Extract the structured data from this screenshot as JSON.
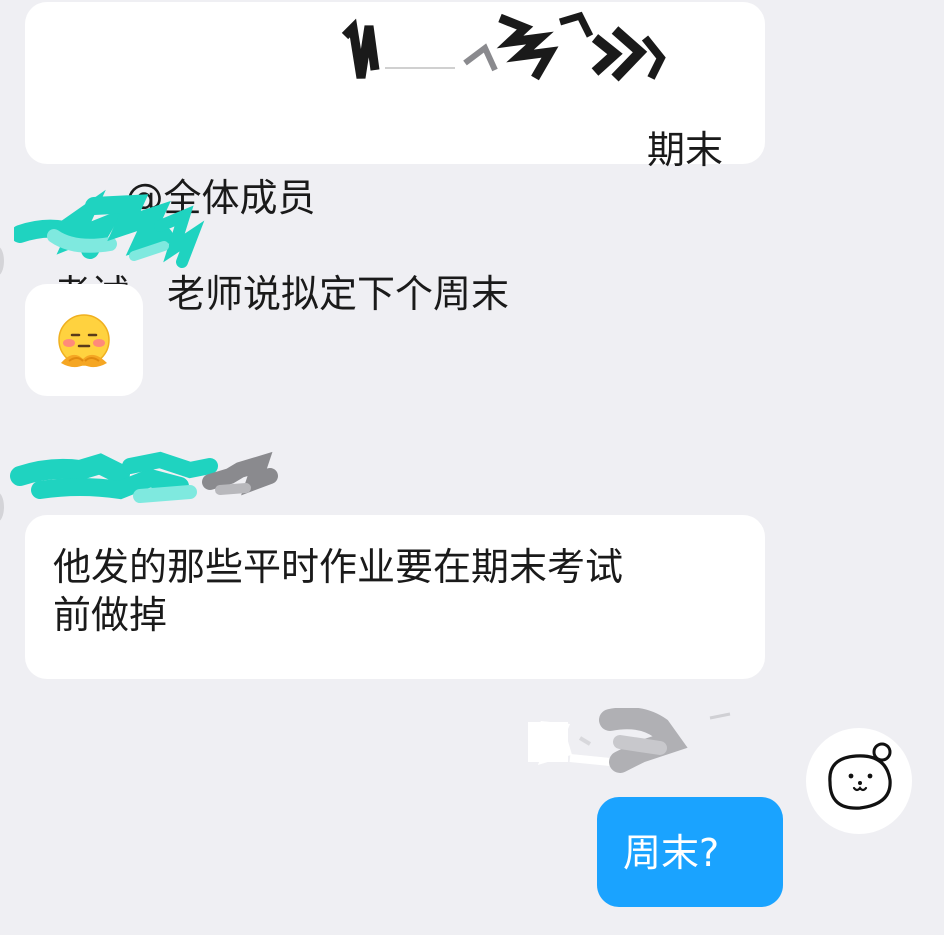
{
  "colors": {
    "background": "#efeff3",
    "incoming_bubble": "#ffffff",
    "outgoing_bubble": "#1aa3ff",
    "redaction_teal": "#1fd3c0",
    "redaction_gray": "#8a8a8e",
    "redaction_black": "#1a1a1a"
  },
  "messages": [
    {
      "direction": "incoming",
      "text_prefix": "@全体成员",
      "text_line1_end": "期末",
      "text_line2": "考试，老师说拟定下个周末"
    },
    {
      "direction": "incoming",
      "type": "emoji",
      "emoji_icon": "blushing-hug-emoji"
    },
    {
      "direction": "incoming",
      "text": "他发的那些平时作业要在期末考试\n前做掉"
    },
    {
      "direction": "outgoing",
      "text": "周末?"
    }
  ],
  "self_avatar_icon": "bear-face-icon"
}
